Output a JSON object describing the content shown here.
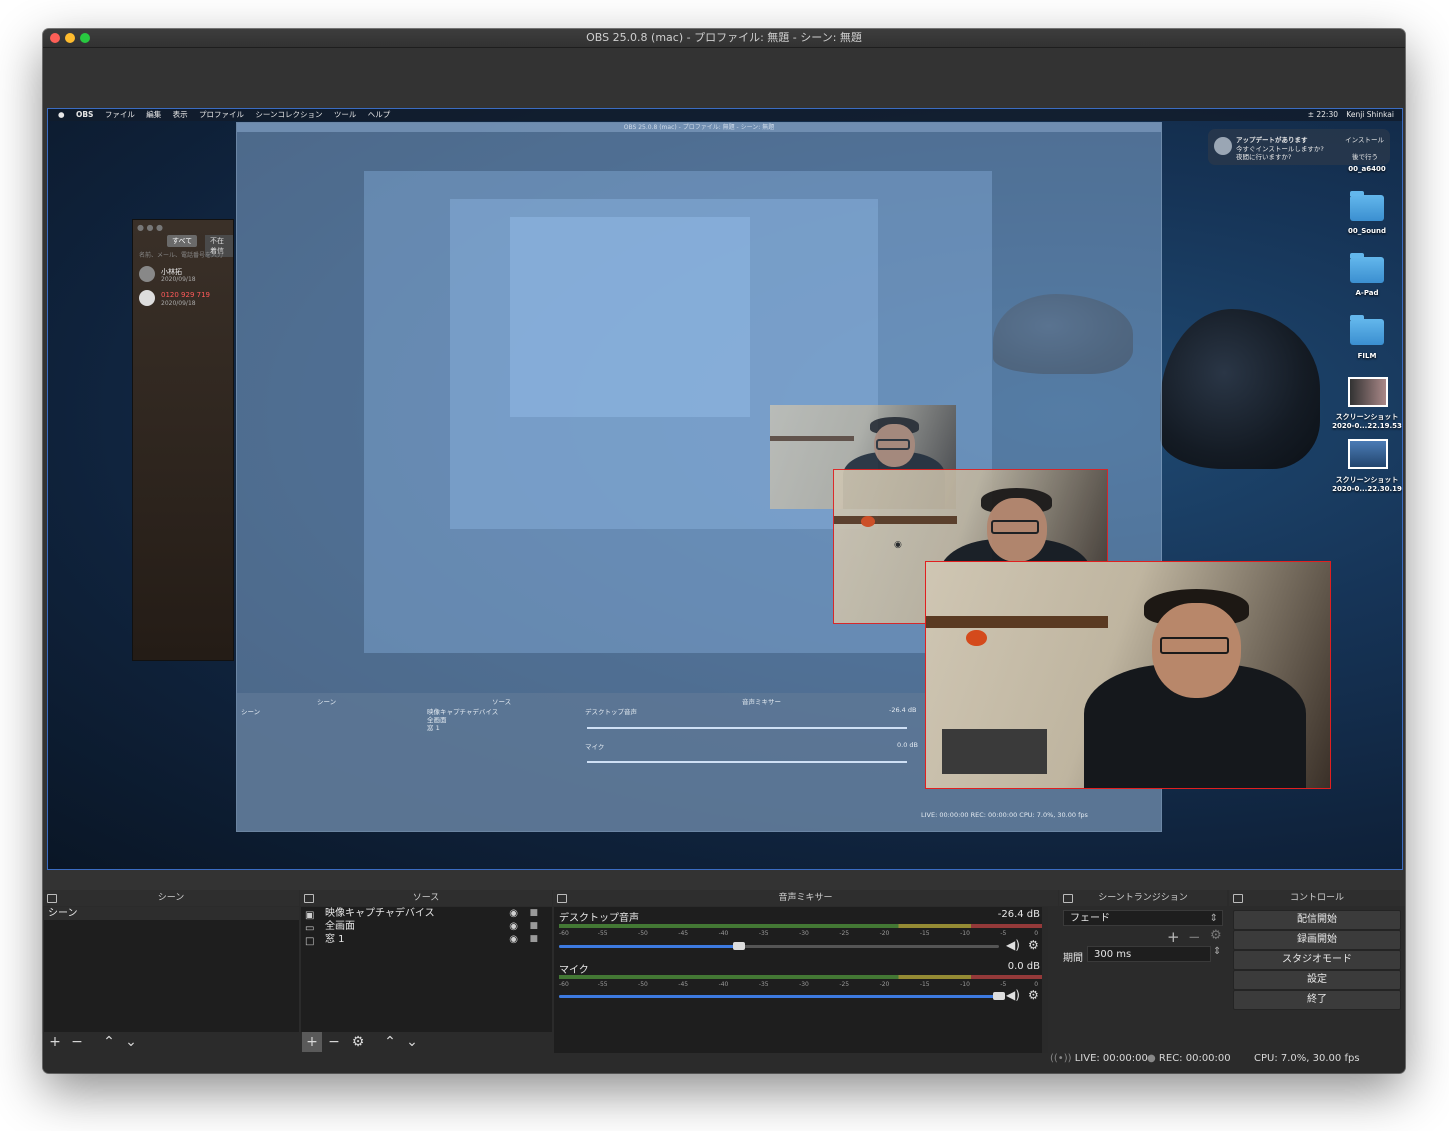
{
  "window": {
    "title": "OBS 25.0.8 (mac) - プロファイル: 無題 - シーン: 無題"
  },
  "preview": {
    "mac_menu": {
      "apple": "",
      "items": [
        "OBS",
        "ファイル",
        "編集",
        "表示",
        "プロファイル",
        "シーンコレクション",
        "ツール",
        "ヘルプ"
      ],
      "clock": "± 22:30",
      "user": "Kenji Shinkai"
    },
    "inner_title": "OBS 25.0.8 (mac) - プロファイル: 無題 - シーン: 無題",
    "notification": {
      "title": "アップデートがあります",
      "body": "今すぐインストールしますか?",
      "body2": "夜間に行いますか?",
      "install": "インストール",
      "later": "後で行う"
    },
    "desktop_items": [
      {
        "label": "00_a6400",
        "kind": "folder"
      },
      {
        "label": "00_Sound",
        "kind": "folder"
      },
      {
        "label": "A-Pad",
        "kind": "folder"
      },
      {
        "label": "FILM",
        "kind": "folder"
      },
      {
        "label": "スクリーンショット 2020-0...22.19.53",
        "kind": "image"
      },
      {
        "label": "スクリーンショット 2020-0...22.30.19",
        "kind": "image"
      }
    ],
    "contacts_window": {
      "tab_all": "すべて",
      "tab_missed": "不在着信",
      "search": "名前、メール、電話番号を入力",
      "rows": [
        {
          "name": "小林拓",
          "date": "2020/09/18"
        },
        {
          "name": "0120 929 719",
          "date": "2020/09/18"
        }
      ]
    },
    "inner_panels": {
      "scene_hdr": "シーン",
      "scene_item": "シーン",
      "source_hdr": "ソース",
      "sources": [
        "映像キャプチャデバイス",
        "全画面",
        "窓 1"
      ],
      "mixer_hdr": "音声ミキサー",
      "mixer1": "デスクトップ音声",
      "mixer1_db": "-26.4 dB",
      "mixer2": "マイク",
      "mixer2_db": "0.0 dB",
      "status": "LIVE: 00:00:00   REC: 00:00:00   CPU: 7.0%, 30.00 fps"
    }
  },
  "scenes": {
    "header": "シーン",
    "items": [
      "シーン"
    ],
    "toolbar": {
      "add": "+",
      "remove": "−",
      "up": "⌃",
      "down": "⌄"
    }
  },
  "sources": {
    "header": "ソース",
    "items": [
      {
        "icon": "camera-icon",
        "label": "映像キャプチャデバイス"
      },
      {
        "icon": "monitor-icon",
        "label": "全画面"
      },
      {
        "icon": "window-icon",
        "label": "窓 1"
      }
    ],
    "toolbar": {
      "add": "+",
      "remove": "−",
      "settings": "⚙",
      "up": "⌃",
      "down": "⌄"
    }
  },
  "mixer": {
    "header": "音声ミキサー",
    "ticks": [
      "-60",
      "-55",
      "-50",
      "-45",
      "-40",
      "-35",
      "-30",
      "-25",
      "-20",
      "-15",
      "-10",
      "-5",
      "0"
    ],
    "channels": [
      {
        "name": "デスクトップ音声",
        "db": "-26.4 dB",
        "volume": 0.41
      },
      {
        "name": "マイク",
        "db": "0.0 dB",
        "volume": 1.0
      }
    ]
  },
  "transitions": {
    "header": "シーントランジション",
    "selected": "フェード",
    "duration_label": "期間",
    "duration_value": "300 ms",
    "add": "+",
    "remove": "−"
  },
  "controls": {
    "header": "コントロール",
    "buttons": [
      "配信開始",
      "録画開始",
      "スタジオモード",
      "設定",
      "終了"
    ]
  },
  "statusbar": {
    "live": "LIVE: 00:00:00",
    "rec": "REC: 00:00:00",
    "cpu": "CPU: 7.0%, 30.00 fps"
  },
  "colors": {
    "window_bg": "#2b2b2b",
    "panel_bg": "#1e1e1e",
    "accent_blue": "#3d7ae0",
    "selection_red": "#e02020"
  }
}
